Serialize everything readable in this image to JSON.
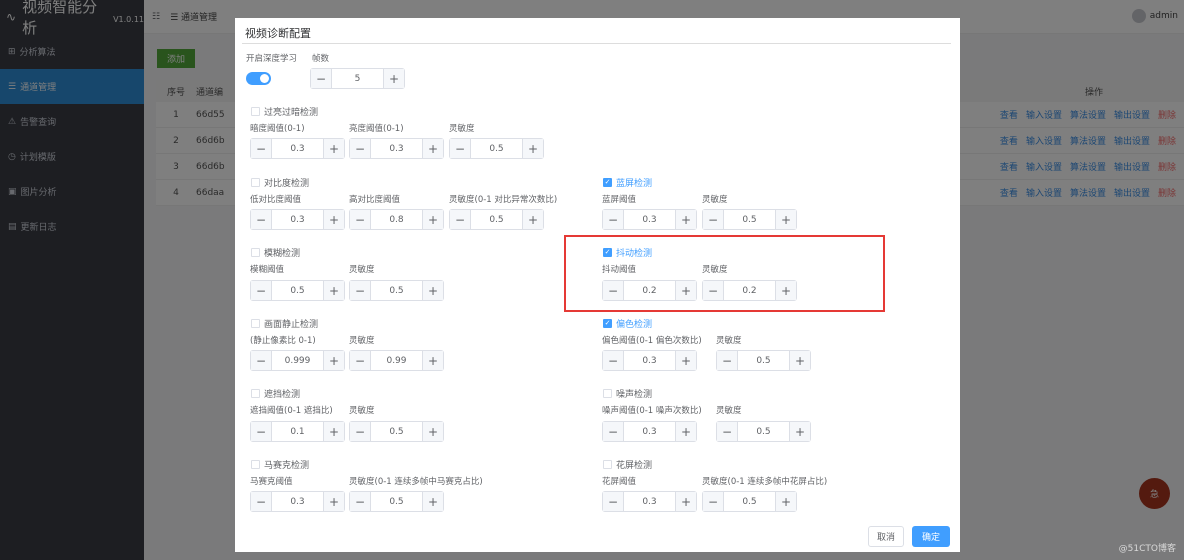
{
  "app": {
    "title": "视频智能分析",
    "version": "V1.0.11"
  },
  "sidebar": {
    "items": [
      {
        "label": "分析算法",
        "icon": "algorithm-icon"
      },
      {
        "label": "通道管理",
        "icon": "channel-icon",
        "active": true
      },
      {
        "label": "告警查询",
        "icon": "alarm-icon"
      },
      {
        "label": "计划模版",
        "icon": "plan-icon"
      },
      {
        "label": "图片分析",
        "icon": "image-icon"
      },
      {
        "label": "更新日志",
        "icon": "log-icon"
      }
    ]
  },
  "topbar": {
    "breadcrumb": "通道管理",
    "user": "admin"
  },
  "main": {
    "add_label": "添加",
    "columns": [
      "序号",
      "通道编",
      "操作"
    ],
    "rows": [
      {
        "no": "1",
        "id": "66d55"
      },
      {
        "no": "2",
        "id": "66d6b"
      },
      {
        "no": "3",
        "id": "66d6b"
      },
      {
        "no": "4",
        "id": "66daa"
      }
    ],
    "ops": [
      "查看",
      "输入设置",
      "算法设置",
      "输出设置",
      "删除"
    ],
    "fab": "急"
  },
  "watermark": "@51CTO博客",
  "dialog": {
    "title": "视频诊断配置",
    "deep_learning_label": "开启深度学习",
    "frames_label": "帧数",
    "frames_value": "5",
    "sections": {
      "brightness": {
        "label": "过亮过暗检测",
        "checked": false,
        "fields": [
          {
            "label": "暗度阈值(0-1)",
            "value": "0.3"
          },
          {
            "label": "亮度阈值(0-1)",
            "value": "0.3"
          },
          {
            "label": "灵敏度",
            "value": "0.5"
          }
        ]
      },
      "contrast": {
        "label": "对比度检测",
        "checked": false,
        "fields": [
          {
            "label": "低对比度阈值",
            "value": "0.3"
          },
          {
            "label": "高对比度阈值",
            "value": "0.8"
          },
          {
            "label": "灵敏度(0-1 对比异常次数比)",
            "value": "0.5"
          }
        ]
      },
      "blue_screen": {
        "label": "蓝屏检测",
        "checked": true,
        "fields": [
          {
            "label": "蓝屏阈值",
            "value": "0.3"
          },
          {
            "label": "灵敏度",
            "value": "0.5"
          }
        ]
      },
      "blur": {
        "label": "模糊检测",
        "checked": false,
        "fields": [
          {
            "label": "模糊阈值",
            "value": "0.5"
          },
          {
            "label": "灵敏度",
            "value": "0.5"
          }
        ]
      },
      "jitter": {
        "label": "抖动检测",
        "checked": true,
        "fields": [
          {
            "label": "抖动阈值",
            "value": "0.2"
          },
          {
            "label": "灵敏度",
            "value": "0.2"
          }
        ]
      },
      "freeze": {
        "label": "画面静止检测",
        "checked": false,
        "fields": [
          {
            "label": "(静止像素比 0-1)",
            "value": "0.999"
          },
          {
            "label": "灵敏度",
            "value": "0.99"
          }
        ]
      },
      "color_cast": {
        "label": "偏色检测",
        "checked": true,
        "fields": [
          {
            "label": "偏色阈值(0-1 偏色次数比)",
            "value": "0.3"
          },
          {
            "label": "灵敏度",
            "value": "0.5"
          }
        ]
      },
      "occlusion": {
        "label": "遮挡检测",
        "checked": false,
        "fields": [
          {
            "label": "遮挡阈值(0-1 遮挡比)",
            "value": "0.1"
          },
          {
            "label": "灵敏度",
            "value": "0.5"
          }
        ]
      },
      "noise": {
        "label": "噪声检测",
        "checked": false,
        "fields": [
          {
            "label": "噪声阈值(0-1 噪声次数比)",
            "value": "0.3"
          },
          {
            "label": "灵敏度",
            "value": "0.5"
          }
        ]
      },
      "mosaic": {
        "label": "马赛克检测",
        "checked": false,
        "fields": [
          {
            "label": "马赛克阈值",
            "value": "0.3"
          },
          {
            "label": "灵敏度(0-1 连续多帧中马赛克占比)",
            "value": "0.5"
          }
        ]
      },
      "snow": {
        "label": "花屏检测",
        "checked": false,
        "fields": [
          {
            "label": "花屏阈值",
            "value": "0.3"
          },
          {
            "label": "灵敏度(0-1 连续多帧中花屏占比)",
            "value": "0.5"
          }
        ]
      }
    },
    "cancel_label": "取消",
    "ok_label": "确定",
    "colors": {
      "primary": "#409eff",
      "highlight": "#e53935"
    }
  }
}
